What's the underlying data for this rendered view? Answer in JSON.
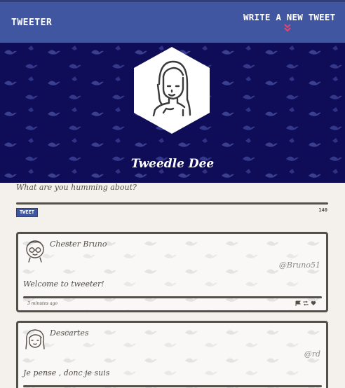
{
  "nav": {
    "brand": "Tweeter",
    "write_label": "Write a new tweet",
    "write_icon": "double-chevron-down-icon",
    "accent": "#4056a1",
    "chevron_color": "#e8426d"
  },
  "profile": {
    "name": "Tweedle Dee",
    "banner_color": "#0f0d57"
  },
  "compose": {
    "placeholder": "What are you humming about?",
    "button_label": "Tweet",
    "counter": "140"
  },
  "tweets": [
    {
      "name": "Chester Bruno",
      "handle": "@Bruno51",
      "text": "Welcome to tweeter!",
      "time": "3 minutes ago",
      "avatar_icon": "glasses-person-avatar-icon"
    },
    {
      "name": "Descartes",
      "handle": "@rd",
      "text": "Je pense , donc je suis",
      "time": "",
      "avatar_icon": "person-avatar-icon"
    }
  ]
}
